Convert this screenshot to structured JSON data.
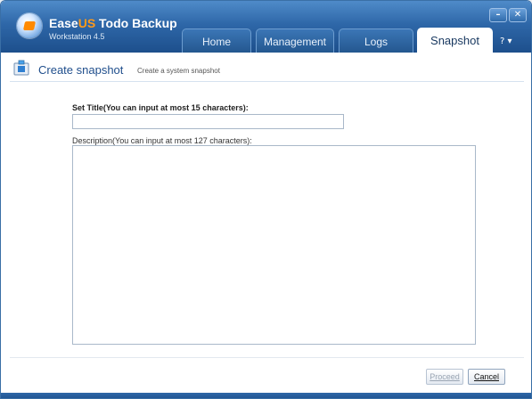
{
  "window": {
    "brand_part1": "Ease",
    "brand_part2": "US",
    "brand_part3": " Todo Backup",
    "version": "Workstation 4.5",
    "minimize_glyph": "–",
    "close_glyph": "✕"
  },
  "tabs": [
    {
      "label": "Home",
      "active": false
    },
    {
      "label": "Management",
      "active": false
    },
    {
      "label": "Logs",
      "active": false
    },
    {
      "label": "Snapshot",
      "active": true
    }
  ],
  "help": {
    "glyph": "? ▾",
    "icon": "help-icon"
  },
  "page": {
    "icon": "snapshot-icon",
    "title": "Create snapshot",
    "subtitle": "Create a system snapshot"
  },
  "form": {
    "title_label": "Set Title(You can input at most 15 characters):",
    "title_value": "",
    "description_label": "Description(You can input at most 127 characters):",
    "description_value": ""
  },
  "buttons": {
    "proceed_label": "Proceed",
    "proceed_enabled": false,
    "cancel_label": "Cancel"
  },
  "colors": {
    "titlebar": "#2e67a8",
    "brand_accent": "#ff9a1a",
    "page_title": "#1f4e8c"
  }
}
